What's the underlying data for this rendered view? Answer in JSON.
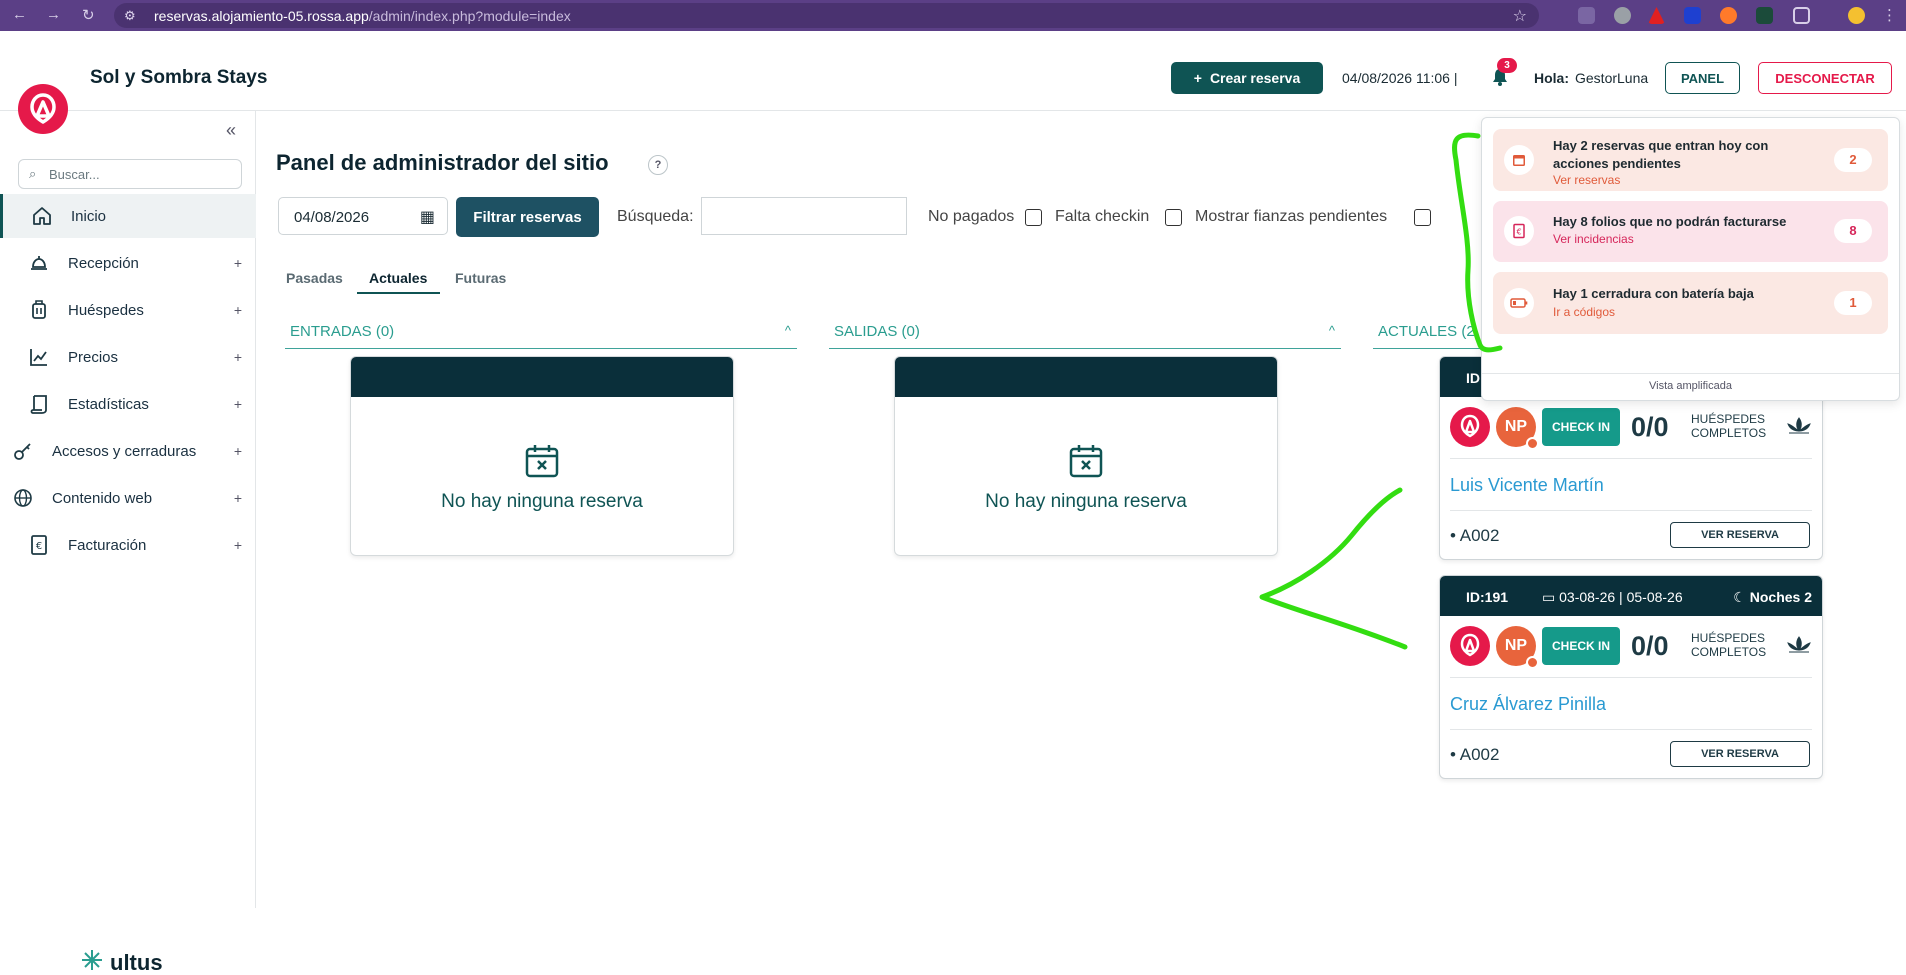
{
  "browser": {
    "url_main": "reservas.alojamiento-05.rossa.app",
    "url_path": "/admin/index.php?module=index"
  },
  "header": {
    "brand": "Sol y Sombra Stays",
    "create_label": "Crear reserva",
    "datetime": "04/08/2026 11:06 |",
    "bell_count": "3",
    "greeting": "Hola:",
    "username": "GestorLuna",
    "panel_label": "PANEL",
    "logout_label": "DESCONECTAR"
  },
  "sidebar": {
    "search_placeholder": "Buscar...",
    "items": [
      {
        "label": "Inicio",
        "icon": "home-icon",
        "expandable": false
      },
      {
        "label": "Recepción",
        "icon": "bell-desk-icon",
        "expandable": true
      },
      {
        "label": "Huéspedes",
        "icon": "luggage-icon",
        "expandable": true
      },
      {
        "label": "Precios",
        "icon": "chart-line-icon",
        "expandable": true
      },
      {
        "label": "Estadísticas",
        "icon": "scroll-icon",
        "expandable": true
      },
      {
        "label": "Accesos y cerraduras",
        "icon": "key-icon",
        "expandable": true
      },
      {
        "label": "Contenido web",
        "icon": "globe-icon",
        "expandable": true
      },
      {
        "label": "Facturación",
        "icon": "euro-invoice-icon",
        "expandable": true
      }
    ],
    "footer_brand": "ultus"
  },
  "main": {
    "title": "Panel de administrador del sitio",
    "help": "?",
    "date_value": "04/08/2026",
    "filter_label": "Filtrar reservas",
    "search_label": "Búsqueda:",
    "search_value": "",
    "checks": {
      "no_pagados": "No pagados",
      "falta_checkin": "Falta checkin",
      "fianzas": "Mostrar fianzas pendientes"
    },
    "tabs": [
      "Pasadas",
      "Actuales",
      "Futuras"
    ],
    "active_tab": "Actuales",
    "columns": {
      "entradas": "ENTRADAS (0)",
      "salidas": "SALIDAS (0)",
      "actuales": "ACTUALES (2"
    },
    "empty_text": "No hay ninguna reserva"
  },
  "reservations": [
    {
      "id": "ID:",
      "guest_initials": "NP",
      "checkin_label": "CHECK IN",
      "guest_count": "0/0",
      "guest_label_1": "HUÉSPEDES",
      "guest_label_2": "COMPLETOS",
      "name": "Luis Vicente Martín",
      "room": "• A002",
      "view_label": "VER RESERVA"
    },
    {
      "id": "ID:191",
      "dates": "03-08-26 | 05-08-26",
      "nights": "Noches 2",
      "guest_initials": "NP",
      "checkin_label": "CHECK IN",
      "guest_count": "0/0",
      "guest_label_1": "HUÉSPEDES",
      "guest_label_2": "COMPLETOS",
      "name": "Cruz Álvarez Pinilla",
      "room": "• A002",
      "view_label": "VER RESERVA"
    }
  ],
  "notifications": {
    "items": [
      {
        "title": "Hay 2 reservas que entran hoy con acciones pendientes",
        "link": "Ver reservas",
        "count": "2",
        "bg": "#fbe8e3",
        "accent": "#e05a3a",
        "icon": "calendar-icon"
      },
      {
        "title": "Hay 8 folios que no podrán facturarse",
        "link": "Ver incidencias",
        "count": "8",
        "bg": "#fbe3ea",
        "accent": "#d6265a",
        "icon": "euro-invoice-icon"
      },
      {
        "title": "Hay 1 cerradura con batería baja",
        "link": "Ir a códigos",
        "count": "1",
        "bg": "#fbe8e3",
        "accent": "#e05a3a",
        "icon": "battery-low-icon"
      }
    ],
    "footer": "Vista amplificada"
  },
  "colors": {
    "accent": "#0f5454",
    "brand_red": "#e5194a",
    "teal": "#2a9d8f",
    "annotation_green": "#33dd11"
  }
}
